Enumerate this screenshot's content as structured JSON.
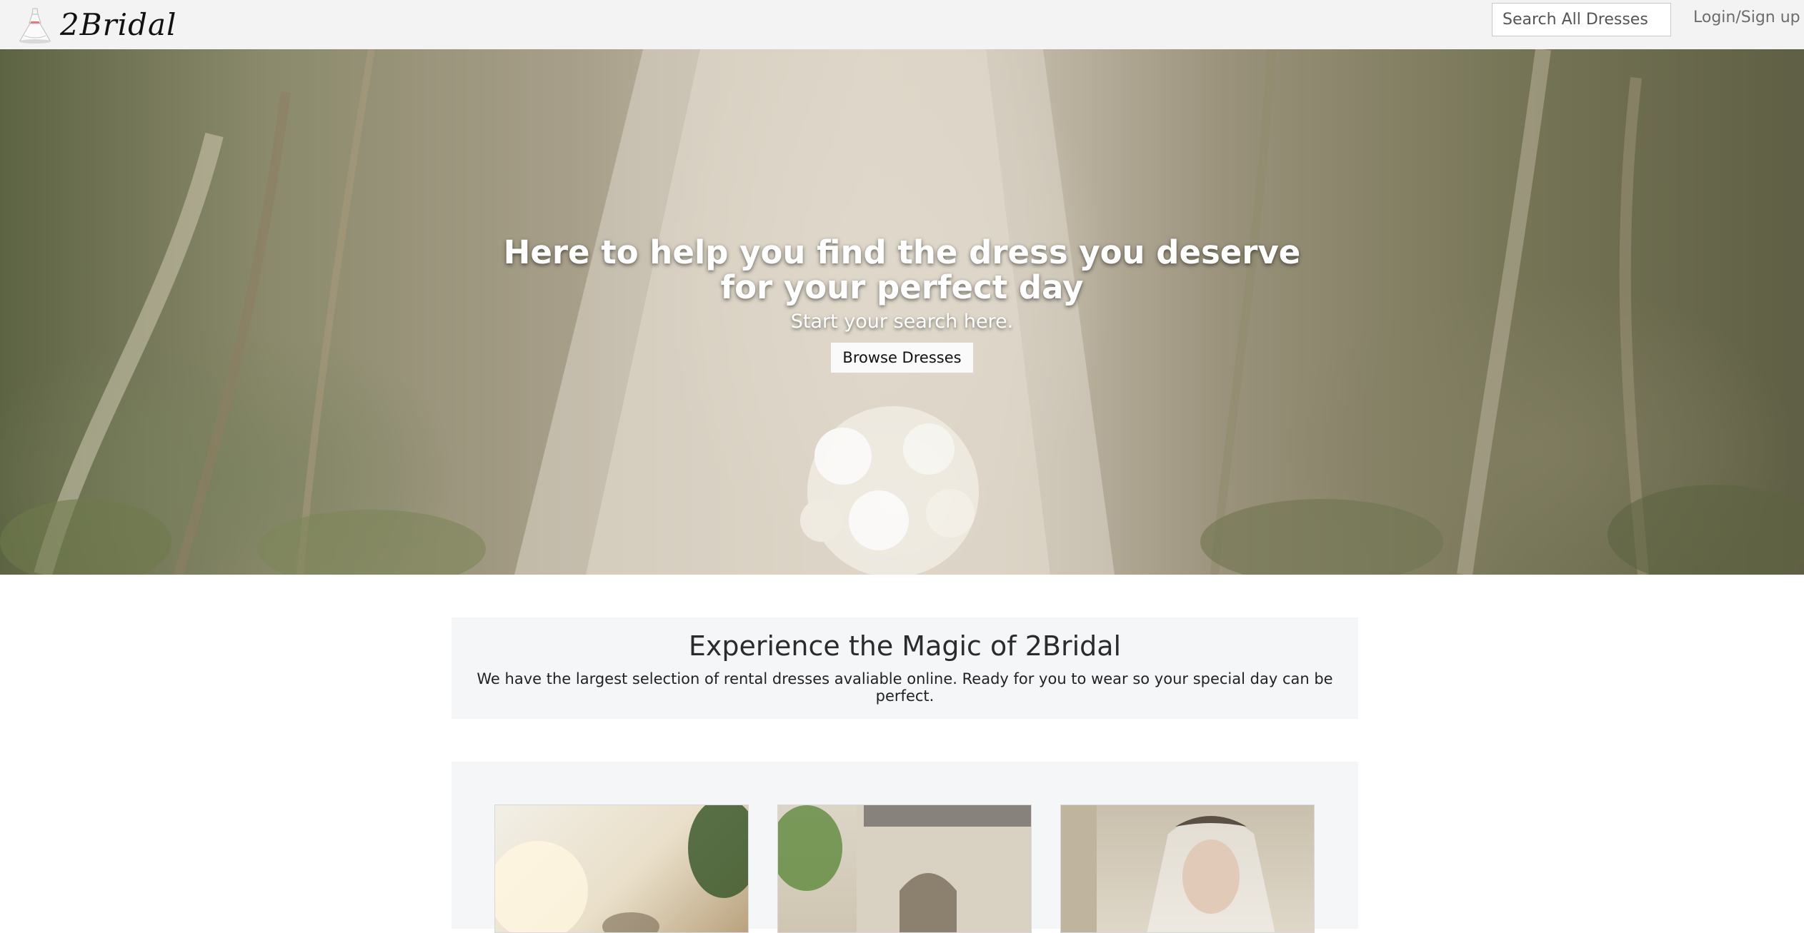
{
  "navbar": {
    "brand_icon": "wedding-dress-icon",
    "brand_name": "2Bridal",
    "search_placeholder": "Search All Dresses",
    "login_label": "Login/Sign up"
  },
  "hero": {
    "title": "Here to help you find the dress you deserve for your perfect day",
    "subtitle": "Start your search here.",
    "button_label": "Browse Dresses"
  },
  "magic": {
    "title": "Experience the Magic of 2Bridal",
    "text": "We have the largest selection of rental dresses avaliable online. Ready for you to wear so your special day can be perfect."
  },
  "colors": {
    "navbar_bg": "#f3f3f3",
    "section_bg": "#f5f6f8",
    "hero_text": "#ffffff"
  }
}
